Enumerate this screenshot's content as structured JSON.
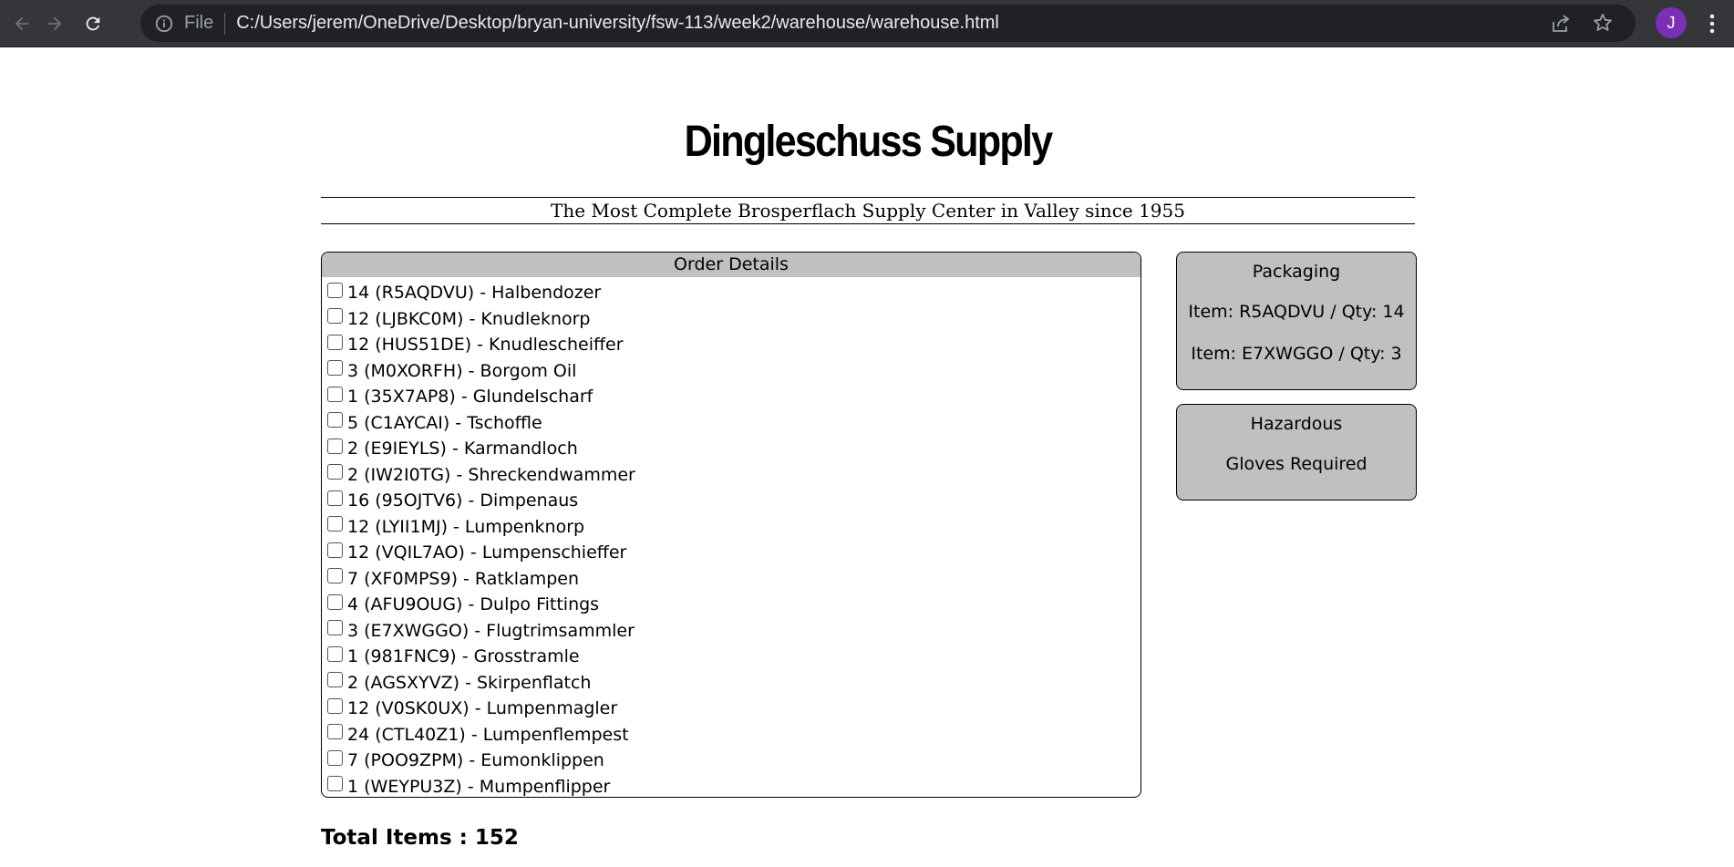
{
  "browser": {
    "file_label": "File",
    "url": "C:/Users/jerem/OneDrive/Desktop/bryan-university/fsw-113/week2/warehouse/warehouse.html",
    "avatar_letter": "J",
    "avatar_color": "#7b2fb5",
    "icons": [
      "back-arrow-icon",
      "forward-arrow-icon",
      "reload-icon",
      "info-icon",
      "share-icon",
      "star-icon",
      "kebab-menu-icon"
    ]
  },
  "page": {
    "title": "Dingleschuss Supply",
    "subtitle": "The Most Complete Brosperflach Supply Center in Valley since 1955"
  },
  "order": {
    "header": "Order Details",
    "items": [
      "14 (R5AQDVU) - Halbendozer",
      "12 (LJBKC0M) - Knudleknorp",
      "12 (HUS51DE) - Knudlescheiffer",
      "3 (M0XORFH) - Borgom Oil",
      "1 (35X7AP8) - Glundelscharf",
      "5 (C1AYCAI) - Tschoffle",
      "2 (E9IEYLS) - Karmandloch",
      "2 (IW2I0TG) - Shreckendwammer",
      "16 (95OJTV6) - Dimpenaus",
      "12 (LYII1MJ) - Lumpenknorp",
      "12 (VQIL7AO) - Lumpenschieffer",
      "7 (XF0MPS9) - Ratklampen",
      "4 (AFU9OUG) - Dulpo Fittings",
      "3 (E7XWGGO) - Flugtrimsammler",
      "1 (981FNC9) - Grosstramle",
      "2 (AGSXYVZ) - Skirpenflatch",
      "12 (V0SK0UX) - Lumpenmagler",
      "24 (CTL40Z1) - Lumpenflempest",
      "7 (POO9ZPM) - Eumonklippen",
      "1 (WEYPU3Z) - Mumpenflipper"
    ]
  },
  "packaging": {
    "title": "Packaging",
    "lines": [
      "Item: R5AQDVU / Qty: 14",
      "Item: E7XWGGO / Qty: 3"
    ]
  },
  "hazardous": {
    "title": "Hazardous",
    "lines": [
      "Gloves Required"
    ]
  },
  "total": "Total Items : 152",
  "colors": {
    "chrome_bg": "#35363a",
    "omnibox_bg": "#202124",
    "panel_gray": "#c0c0c0"
  }
}
